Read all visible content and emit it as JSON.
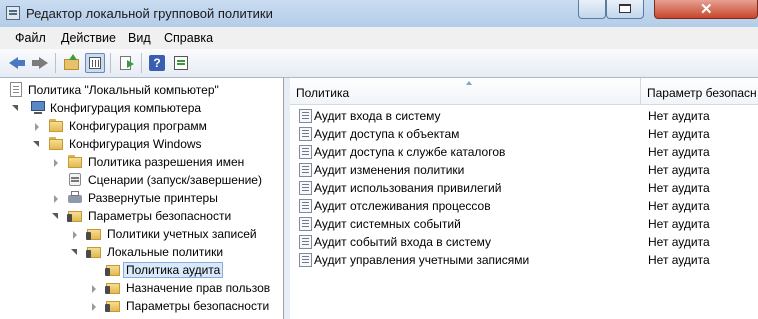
{
  "window": {
    "title": "Редактор локальной групповой политики",
    "close_symbol": "✕"
  },
  "menu": [
    "Файл",
    "Действие",
    "Вид",
    "Справка"
  ],
  "toolbar": {
    "icons": [
      "back-arrow-icon",
      "forward-arrow-icon",
      "up-folder-icon",
      "show-hide-tree-icon",
      "export-list-icon",
      "help-icon",
      "properties-icon"
    ],
    "accent": "#4a78c2"
  },
  "tree": {
    "items": [
      {
        "label": "Политика \"Локальный компьютер\"",
        "icon": "document-icon"
      },
      {
        "label": "Конфигурация компьютера",
        "icon": "computer-icon"
      },
      {
        "label": "Конфигурация программ",
        "icon": "folder-icon"
      },
      {
        "label": "Конфигурация Windows",
        "icon": "folder-icon"
      },
      {
        "label": "Политика разрешения имен",
        "icon": "folder-icon"
      },
      {
        "label": "Сценарии (запуск/завершение)",
        "icon": "script-icon"
      },
      {
        "label": "Развернутые принтеры",
        "icon": "printer-icon"
      },
      {
        "label": "Параметры безопасности",
        "icon": "security-icon"
      },
      {
        "label": "Политики учетных записей",
        "icon": "security-folder-icon"
      },
      {
        "label": "Локальные политики",
        "icon": "security-folder-icon"
      },
      {
        "label": "Политика аудита",
        "icon": "security-folder-icon",
        "selected": true
      },
      {
        "label": "Назначение прав пользов",
        "icon": "security-folder-icon"
      },
      {
        "label": "Параметры безопасности",
        "icon": "security-folder-icon"
      }
    ]
  },
  "list": {
    "columns": [
      "Политика",
      "Параметр безопасн"
    ],
    "rows": [
      {
        "policy": "Аудит входа в систему",
        "value": "Нет аудита"
      },
      {
        "policy": "Аудит доступа к объектам",
        "value": "Нет аудита"
      },
      {
        "policy": "Аудит доступа к службе каталогов",
        "value": "Нет аудита"
      },
      {
        "policy": "Аудит изменения политики",
        "value": "Нет аудита"
      },
      {
        "policy": "Аудит использования привилегий",
        "value": "Нет аудита"
      },
      {
        "policy": "Аудит отслеживания процессов",
        "value": "Нет аудита"
      },
      {
        "policy": "Аудит системных событий",
        "value": "Нет аудита"
      },
      {
        "policy": "Аудит событий входа в систему",
        "value": "Нет аудита"
      },
      {
        "policy": "Аудит управления учетными записями",
        "value": "Нет аудита"
      }
    ]
  }
}
